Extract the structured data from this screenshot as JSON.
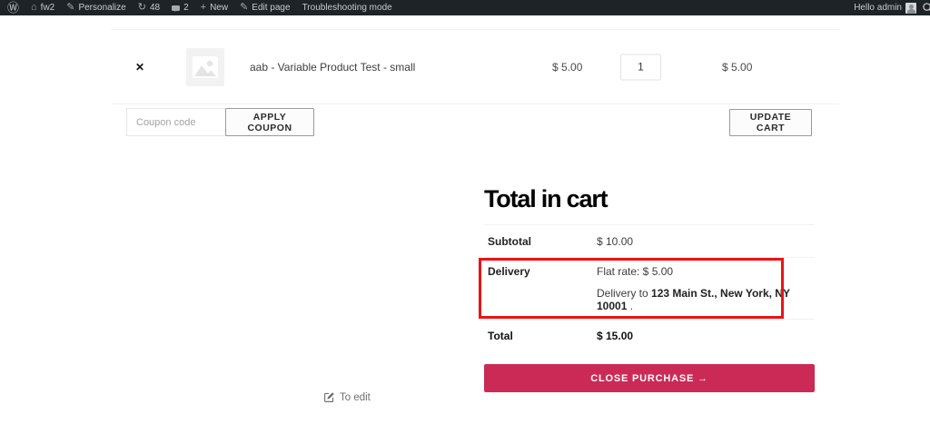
{
  "adminbar": {
    "items": [
      {
        "label": "fw2"
      },
      {
        "label": "Personalize"
      },
      {
        "label": "48"
      },
      {
        "label": "2"
      },
      {
        "label": "New"
      },
      {
        "label": "Edit page"
      },
      {
        "label": "Troubleshooting mode"
      }
    ],
    "greeting": "Hello admin"
  },
  "icons": {
    "wp_logo": "Ⓦ",
    "home": "⌂",
    "pencil": "✎",
    "update": "↻",
    "plus": "+",
    "remove": "✕"
  },
  "cart": {
    "item": {
      "name": "aab - Variable Product Test - small",
      "price": "$ 5.00",
      "quantity": "1",
      "subtotal": "$ 5.00"
    },
    "coupon": {
      "placeholder": "Coupon code",
      "apply_label": "APPLY COUPON"
    },
    "update_cart_label": "UPDATE CART"
  },
  "totals": {
    "title": "Total in cart",
    "subtotal_label": "Subtotal",
    "subtotal_value": "$ 10.00",
    "delivery_label": "Delivery",
    "delivery_method": "Flat rate: $ 5.00",
    "delivery_to_prefix": "Delivery to ",
    "delivery_address": "123 Main St., New York, NY 10001",
    "delivery_to_suffix": " .",
    "total_label": "Total",
    "total_value": "$ 15.00",
    "checkout_label": "CLOSE PURCHASE →"
  },
  "footer": {
    "edit_label": "To edit"
  },
  "colors": {
    "accent": "#cb2a56",
    "highlight_red": "#ec1313",
    "adminbar_bg": "#1d2327"
  }
}
